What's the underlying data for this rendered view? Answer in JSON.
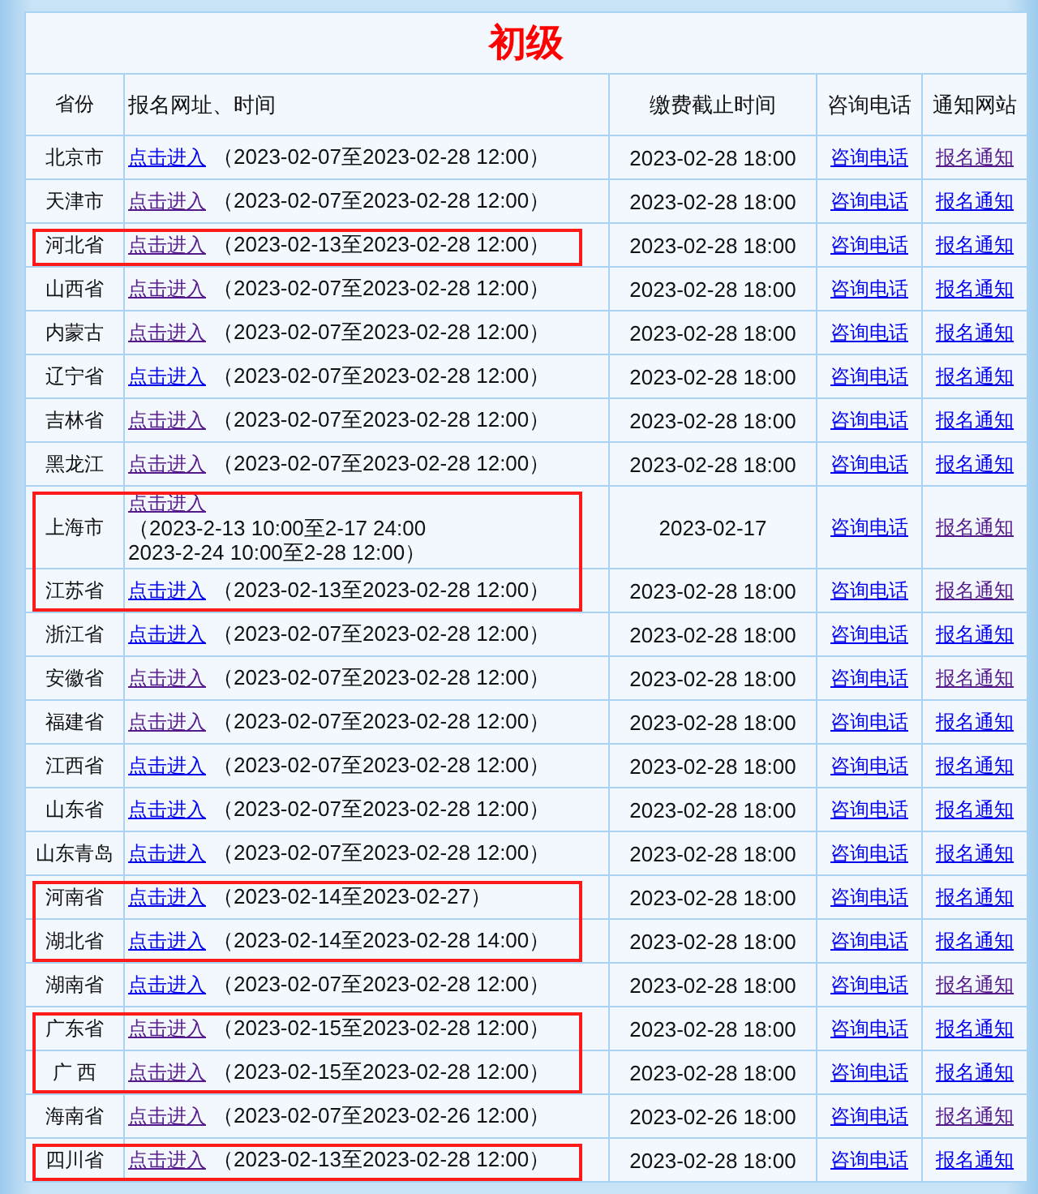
{
  "title": "初级",
  "columns": [
    "省份",
    "报名网址、时间",
    "缴费截止时间",
    "咨询电话",
    "通知网站"
  ],
  "rows": [
    {
      "province": "北京市",
      "link": {
        "label": "点击进入",
        "visited": false
      },
      "time": [
        "（2023-02-07至2023-02-28 12:00）"
      ],
      "fee_deadline": "2023-02-28 18:00",
      "phone": {
        "label": "咨询电话",
        "visited": false
      },
      "notice": {
        "label": "报名通知",
        "visited": true
      },
      "marked": false
    },
    {
      "province": "天津市",
      "link": {
        "label": "点击进入",
        "visited": true
      },
      "time": [
        "（2023-02-07至2023-02-28 12:00）"
      ],
      "fee_deadline": "2023-02-28 18:00",
      "phone": {
        "label": "咨询电话",
        "visited": false
      },
      "notice": {
        "label": "报名通知",
        "visited": false
      },
      "marked": false
    },
    {
      "province": "河北省",
      "link": {
        "label": "点击进入",
        "visited": true
      },
      "time": [
        "（2023-02-13至2023-02-28 12:00）"
      ],
      "fee_deadline": "2023-02-28 18:00",
      "phone": {
        "label": "咨询电话",
        "visited": false
      },
      "notice": {
        "label": "报名通知",
        "visited": false
      },
      "marked": true
    },
    {
      "province": "山西省",
      "link": {
        "label": "点击进入",
        "visited": true
      },
      "time": [
        "（2023-02-07至2023-02-28 12:00）"
      ],
      "fee_deadline": "2023-02-28 18:00",
      "phone": {
        "label": "咨询电话",
        "visited": false
      },
      "notice": {
        "label": "报名通知",
        "visited": false
      },
      "marked": false
    },
    {
      "province": "内蒙古",
      "link": {
        "label": "点击进入",
        "visited": true
      },
      "time": [
        "（2023-02-07至2023-02-28 12:00）"
      ],
      "fee_deadline": "2023-02-28 18:00",
      "phone": {
        "label": "咨询电话",
        "visited": false
      },
      "notice": {
        "label": "报名通知",
        "visited": false
      },
      "marked": false
    },
    {
      "province": "辽宁省",
      "link": {
        "label": "点击进入",
        "visited": false
      },
      "time": [
        "（2023-02-07至2023-02-28 12:00）"
      ],
      "fee_deadline": "2023-02-28 18:00",
      "phone": {
        "label": "咨询电话",
        "visited": false
      },
      "notice": {
        "label": "报名通知",
        "visited": false
      },
      "marked": false
    },
    {
      "province": "吉林省",
      "link": {
        "label": "点击进入",
        "visited": true
      },
      "time": [
        "（2023-02-07至2023-02-28 12:00）"
      ],
      "fee_deadline": "2023-02-28 18:00",
      "phone": {
        "label": "咨询电话",
        "visited": false
      },
      "notice": {
        "label": "报名通知",
        "visited": false
      },
      "marked": false
    },
    {
      "province": "黑龙江",
      "link": {
        "label": "点击进入",
        "visited": true
      },
      "time": [
        "（2023-02-07至2023-02-28 12:00）"
      ],
      "fee_deadline": "2023-02-28 18:00",
      "phone": {
        "label": "咨询电话",
        "visited": false
      },
      "notice": {
        "label": "报名通知",
        "visited": false
      },
      "marked": false
    },
    {
      "province": "上海市",
      "link": {
        "label": "点击进入",
        "visited": true
      },
      "time": [
        "（2023-2-13 10:00至2-17 24:00",
        "2023-2-24 10:00至2-28 12:00）"
      ],
      "fee_deadline": "2023-02-17",
      "phone": {
        "label": "咨询电话",
        "visited": false
      },
      "notice": {
        "label": "报名通知",
        "visited": true
      },
      "marked": true
    },
    {
      "province": "江苏省",
      "link": {
        "label": "点击进入",
        "visited": false
      },
      "time": [
        "（2023-02-13至2023-02-28 12:00）"
      ],
      "fee_deadline": "2023-02-28 18:00",
      "phone": {
        "label": "咨询电话",
        "visited": false
      },
      "notice": {
        "label": "报名通知",
        "visited": true
      },
      "marked": true
    },
    {
      "province": "浙江省",
      "link": {
        "label": "点击进入",
        "visited": false
      },
      "time": [
        "（2023-02-07至2023-02-28 12:00）"
      ],
      "fee_deadline": "2023-02-28 18:00",
      "phone": {
        "label": "咨询电话",
        "visited": false
      },
      "notice": {
        "label": "报名通知",
        "visited": false
      },
      "marked": false
    },
    {
      "province": "安徽省",
      "link": {
        "label": "点击进入",
        "visited": true
      },
      "time": [
        "（2023-02-07至2023-02-28 12:00）"
      ],
      "fee_deadline": "2023-02-28 18:00",
      "phone": {
        "label": "咨询电话",
        "visited": false
      },
      "notice": {
        "label": "报名通知",
        "visited": true
      },
      "marked": false
    },
    {
      "province": "福建省",
      "link": {
        "label": "点击进入",
        "visited": true
      },
      "time": [
        "（2023-02-07至2023-02-28 12:00）"
      ],
      "fee_deadline": "2023-02-28 18:00",
      "phone": {
        "label": "咨询电话",
        "visited": false
      },
      "notice": {
        "label": "报名通知",
        "visited": false
      },
      "marked": false
    },
    {
      "province": "江西省",
      "link": {
        "label": "点击进入",
        "visited": false
      },
      "time": [
        "（2023-02-07至2023-02-28 12:00）"
      ],
      "fee_deadline": "2023-02-28 18:00",
      "phone": {
        "label": "咨询电话",
        "visited": false
      },
      "notice": {
        "label": "报名通知",
        "visited": false
      },
      "marked": false
    },
    {
      "province": "山东省",
      "link": {
        "label": "点击进入",
        "visited": false
      },
      "time": [
        "（2023-02-07至2023-02-28 12:00）"
      ],
      "fee_deadline": "2023-02-28 18:00",
      "phone": {
        "label": "咨询电话",
        "visited": false
      },
      "notice": {
        "label": "报名通知",
        "visited": false
      },
      "marked": false
    },
    {
      "province": "山东青岛",
      "link": {
        "label": "点击进入",
        "visited": false
      },
      "time": [
        "（2023-02-07至2023-02-28 12:00）"
      ],
      "fee_deadline": "2023-02-28 18:00",
      "phone": {
        "label": "咨询电话",
        "visited": false
      },
      "notice": {
        "label": "报名通知",
        "visited": false
      },
      "marked": false
    },
    {
      "province": "河南省",
      "link": {
        "label": "点击进入",
        "visited": false
      },
      "time": [
        "（2023-02-14至2023-02-27）"
      ],
      "fee_deadline": "2023-02-28 18:00",
      "phone": {
        "label": "咨询电话",
        "visited": false
      },
      "notice": {
        "label": "报名通知",
        "visited": false
      },
      "marked": true
    },
    {
      "province": "湖北省",
      "link": {
        "label": "点击进入",
        "visited": false
      },
      "time": [
        "（2023-02-14至2023-02-28 14:00）"
      ],
      "fee_deadline": "2023-02-28 18:00",
      "phone": {
        "label": "咨询电话",
        "visited": false
      },
      "notice": {
        "label": "报名通知",
        "visited": false
      },
      "marked": true
    },
    {
      "province": "湖南省",
      "link": {
        "label": "点击进入",
        "visited": false
      },
      "time": [
        "（2023-02-07至2023-02-28 12:00）"
      ],
      "fee_deadline": "2023-02-28 18:00",
      "phone": {
        "label": "咨询电话",
        "visited": false
      },
      "notice": {
        "label": "报名通知",
        "visited": true
      },
      "marked": false
    },
    {
      "province": "广东省",
      "link": {
        "label": "点击进入",
        "visited": true
      },
      "time": [
        "（2023-02-15至2023-02-28 12:00）"
      ],
      "fee_deadline": "2023-02-28 18:00",
      "phone": {
        "label": "咨询电话",
        "visited": false
      },
      "notice": {
        "label": "报名通知",
        "visited": false
      },
      "marked": true
    },
    {
      "province": "广 西",
      "link": {
        "label": "点击进入",
        "visited": true
      },
      "time": [
        "（2023-02-15至2023-02-28 12:00）"
      ],
      "fee_deadline": "2023-02-28 18:00",
      "phone": {
        "label": "咨询电话",
        "visited": false
      },
      "notice": {
        "label": "报名通知",
        "visited": false
      },
      "marked": true
    },
    {
      "province": "海南省",
      "link": {
        "label": "点击进入",
        "visited": true
      },
      "time": [
        "（2023-02-07至2023-02-26 12:00）"
      ],
      "fee_deadline": "2023-02-26 18:00",
      "phone": {
        "label": "咨询电话",
        "visited": false
      },
      "notice": {
        "label": "报名通知",
        "visited": true
      },
      "marked": false
    },
    {
      "province": "四川省",
      "link": {
        "label": "点击进入",
        "visited": true
      },
      "time": [
        "（2023-02-13至2023-02-28 12:00）"
      ],
      "fee_deadline": "2023-02-28 18:00",
      "phone": {
        "label": "咨询电话",
        "visited": false
      },
      "notice": {
        "label": "报名通知",
        "visited": false
      },
      "marked": true
    }
  ]
}
